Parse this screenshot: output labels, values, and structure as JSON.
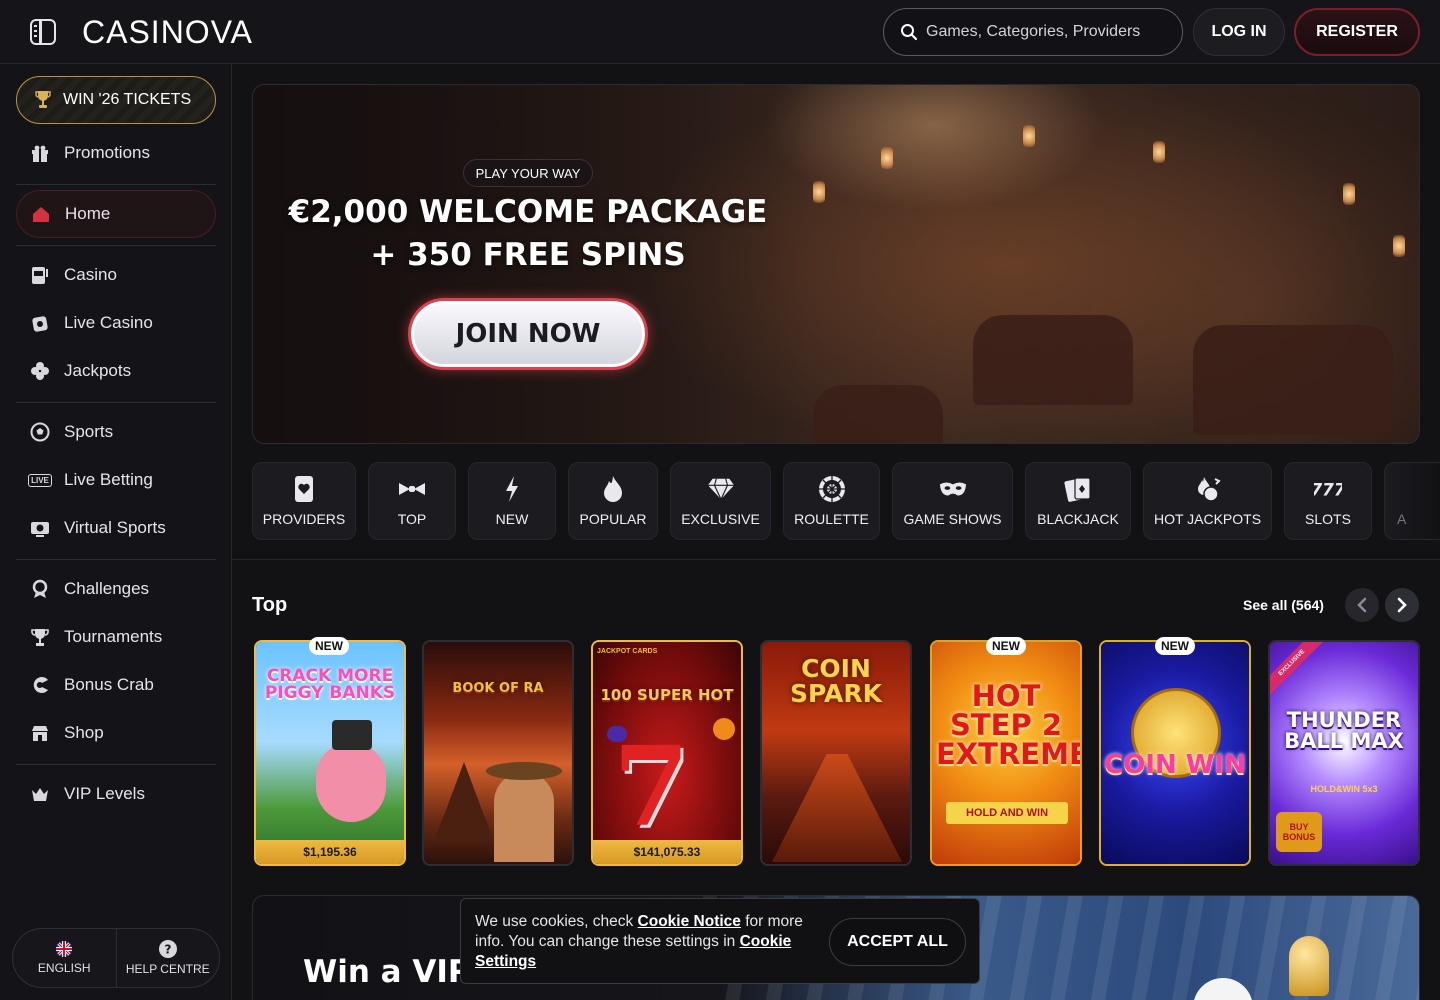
{
  "header": {
    "logo_text": "CASINOVA",
    "search_placeholder": "Games, Categories, Providers",
    "login_label": "LOG IN",
    "register_label": "REGISTER"
  },
  "sidebar": {
    "tickets_label": "WIN '26 TICKETS",
    "promotions": "Promotions",
    "home": "Home",
    "casino": "Casino",
    "live_casino": "Live Casino",
    "jackpots": "Jackpots",
    "sports": "Sports",
    "live_betting": "Live Betting",
    "virtual_sports": "Virtual Sports",
    "challenges": "Challenges",
    "tournaments": "Tournaments",
    "bonus_crab": "Bonus Crab",
    "shop": "Shop",
    "vip_levels": "VIP Levels",
    "language": "ENGLISH",
    "help": "HELP CENTRE",
    "live_badge": "LIVE"
  },
  "hero": {
    "tag": "PLAY YOUR WAY",
    "line1": "€2,000 WELCOME PACKAGE",
    "line2": "+ 350 FREE SPINS",
    "cta": "JOIN NOW"
  },
  "categories": [
    "PROVIDERS",
    "TOP",
    "NEW",
    "POPULAR",
    "EXCLUSIVE",
    "ROULETTE",
    "GAME SHOWS",
    "BLACKJACK",
    "HOT JACKPOTS",
    "SLOTS",
    "A"
  ],
  "top_section": {
    "title": "Top",
    "see_all": "See all (564)",
    "games": [
      {
        "title": "CRACK MORE PIGGY BANKS",
        "badge": "NEW",
        "jackpot": "$1,195.36"
      },
      {
        "title": "BOOK OF RA",
        "badge": "",
        "jackpot": ""
      },
      {
        "title": "100 SUPER HOT",
        "badge": "",
        "jackpot": "$141,075.33",
        "sub": "JACKPOT CARDS"
      },
      {
        "title": "COIN SPARK",
        "badge": "",
        "jackpot": ""
      },
      {
        "title": "HOT STEP 2 EXTREME",
        "badge": "NEW",
        "jackpot": "",
        "sub": "HOLD AND WIN"
      },
      {
        "title": "COIN WIN",
        "badge": "NEW",
        "jackpot": ""
      },
      {
        "title": "THUNDER BALL MAX",
        "badge": "",
        "jackpot": "",
        "sub": "HOLD&WIN 5x3",
        "ribbon": "EXCLUSIVE",
        "extra": "BUY BONUS"
      }
    ]
  },
  "promo": {
    "title": "Win a VIP t"
  },
  "cookie": {
    "text_before": "We use cookies, check",
    "notice_link": "Cookie Notice",
    "text_middle": "for more info. You can change these settings in",
    "settings_link": "Cookie Settings",
    "accept": "ACCEPT ALL"
  },
  "colors": {
    "background": "#121215",
    "register_border": "#7a1f2a",
    "jackpot_bar": "#e5ac33",
    "tickets_border": "#b89440"
  }
}
